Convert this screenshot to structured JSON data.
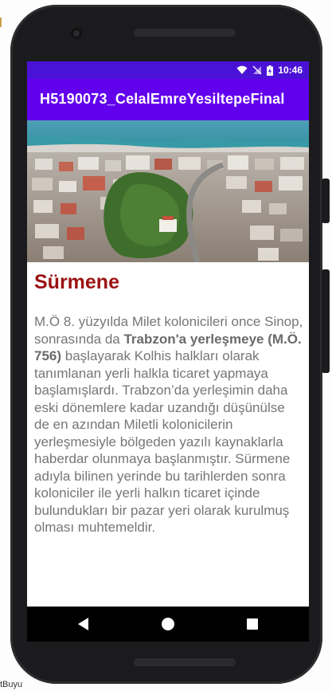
{
  "status_bar": {
    "time": "10:46",
    "icons": [
      "wifi-icon",
      "signal-off-icon",
      "battery-charging-icon"
    ]
  },
  "app_bar": {
    "title": "H5190073_CelalEmreYesiltepeFinal"
  },
  "hero_image": {
    "icon": "city-photo"
  },
  "article": {
    "heading": "Sürmene",
    "para_part1": "M.Ö 8. yüzyılda Milet kolonicileri once Sinop, sonrasında da ",
    "para_bold": "Trabzon'a yerleşmeye (M.Ö. 756)",
    "para_part2": " başlayarak Kolhis halkları olarak tanımlanan yerli halkla ticaret yapmaya başlamışlardı. Trabzon’da yerleşimin daha eski dönemlere kadar uzandığı düşünülse de en azından Miletli kolonicilerin yerleşmesiyle bölgeden yazılı kaynaklarla haberdar olunmaya başlanmıştır. Sürmene adıyla bilinen yerinde bu tarihlerden sonra koloniciler ile yerli halkın ticaret içinde bulundukları bir pazar yeri olarak kurulmuş olması muhtemeldir."
  },
  "nav_bar": {
    "icons": [
      "back-icon",
      "home-icon",
      "recents-icon"
    ]
  },
  "background": {
    "bottom_text": "tBuyu"
  },
  "colors": {
    "status_bar": "#4a12d6",
    "app_bar": "#6200ee",
    "heading": "#9b1212",
    "body_text": "#767676"
  }
}
